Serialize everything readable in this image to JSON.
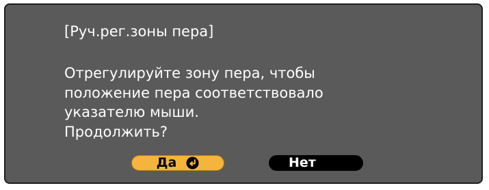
{
  "dialog": {
    "title": "[Руч.рег.зоны пера]",
    "message_lines": [
      "Отрегулируйте зону пера, чтобы",
      "положение пера соответствовало",
      "указателю мыши.",
      "Продолжить?"
    ],
    "buttons": {
      "yes_label": "Да",
      "yes_icon": "enter-icon",
      "no_label": "Нет"
    }
  },
  "colors": {
    "dialog_background": "#5a5a5a",
    "dialog_border": "#1e1e1e",
    "selected_button": "#f5b43c",
    "unselected_button": "#000000",
    "text": "#ffffff"
  }
}
